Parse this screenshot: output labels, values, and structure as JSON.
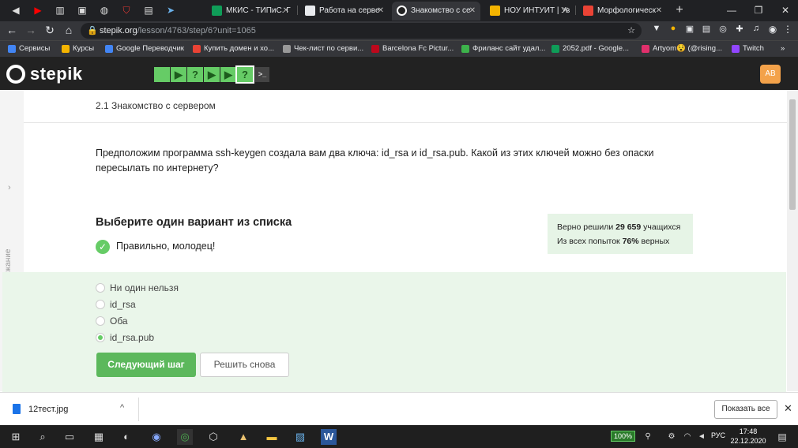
{
  "browser": {
    "tabs": [
      {
        "title": "МКИС - ТИПиС. Г",
        "color": "#0f9d58"
      },
      {
        "title": "Работа на серве",
        "color": "#e8eaed"
      },
      {
        "title": "Знакомство с се",
        "color": "#e8eaed"
      },
      {
        "title": "НОУ ИНТУИТ | Ув",
        "color": "#f4b400"
      },
      {
        "title": "Морфологическ",
        "color": "#ea4335"
      }
    ],
    "new_tab": "+",
    "url_host": "stepik.org",
    "url_path": "/lesson/4763/step/6?unit=1065",
    "bookmarks": [
      {
        "label": "Сервисы",
        "color": "#4285f4"
      },
      {
        "label": "Курсы",
        "color": "#f4b400"
      },
      {
        "label": "Google Переводчик",
        "color": "#4285f4"
      },
      {
        "label": "Купить домен и хо...",
        "color": "#ea4335"
      },
      {
        "label": "Чек-лист по серви...",
        "color": "#999999"
      },
      {
        "label": "Barcelona Fc Pictur...",
        "color": "#bd081c"
      },
      {
        "label": "Фриланс сайт удал...",
        "color": "#3db24b"
      },
      {
        "label": "2052.pdf - Google...",
        "color": "#0f9d58"
      },
      {
        "label": "Artyom😵 (@rising...",
        "color": "#e1306c"
      },
      {
        "label": "Twitch",
        "color": "#9146ff"
      }
    ]
  },
  "stepik": {
    "logo": "stepik",
    "steps": [
      "",
      "▶",
      "?",
      "▶",
      "▶",
      "?",
      ">_"
    ],
    "avatar": "АВ",
    "lesson_title": "2.1 Знакомство с сервером",
    "side_label": "Содержание",
    "question": "Предположим программа ssh-keygen создала вам два ключа: id_rsa и id_rsa.pub. Какой из этих ключей можно без опаски пересылать по интернету?",
    "choose_label": "Выберите один вариант из списка",
    "correct_msg": "Правильно, молодец!",
    "stats_line1_pre": "Верно решили ",
    "stats_line1_num": "29 659",
    "stats_line1_post": " учащихся",
    "stats_line2_pre": "Из всех попыток ",
    "stats_line2_num": "76%",
    "stats_line2_post": " верных",
    "options": [
      "Ни один нельзя",
      "id_rsa",
      "Оба",
      "id_rsa.pub"
    ],
    "selected_option": 3,
    "next_button": "Следующий шаг",
    "retry_button": "Решить снова"
  },
  "downloads": {
    "file": "12тест.jpg",
    "show_all": "Показать все"
  },
  "taskbar": {
    "battery": "100%",
    "lang": "РУС",
    "time": "17:48",
    "date": "22.12.2020"
  }
}
